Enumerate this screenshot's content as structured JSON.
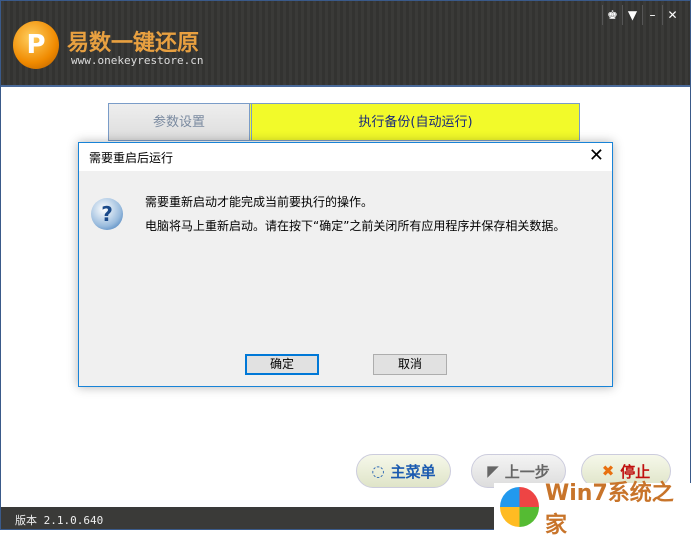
{
  "app": {
    "title": "易数一键还原",
    "url": "www.onekeyrestore.cn",
    "logo_text": "P",
    "controls": [
      "skin",
      "menu",
      "minimize",
      "close"
    ]
  },
  "steps": [
    {
      "label": "参数设置"
    },
    {
      "label": "执行备份(自动运行)"
    }
  ],
  "buttons": {
    "main_menu": "主菜单",
    "back": "上一步",
    "stop": "停止"
  },
  "status": {
    "version": "版本 2.1.0.640"
  },
  "watermark": {
    "text": "Win7系统之家"
  },
  "dialog": {
    "title": "需要重启后运行",
    "line1": "需要重新启动才能完成当前要执行的操作。",
    "line2": "电脑将马上重新启动。请在按下“确定”之前关闭所有应用程序并保存相关数据。",
    "ok": "确定",
    "cancel": "取消"
  }
}
